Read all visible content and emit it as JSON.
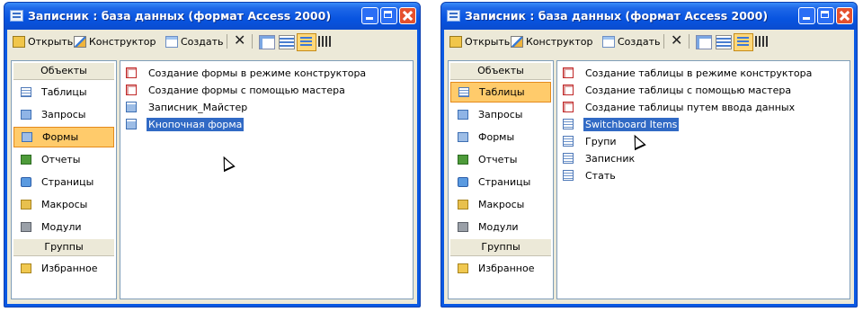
{
  "left": {
    "title": "Записник : база данных (формат Access 2000)",
    "toolbar": {
      "open": "Открыть",
      "design": "Конструктор",
      "create": "Создать",
      "delete": "✕"
    },
    "objects_header": "Объекты",
    "objects": [
      "Таблицы",
      "Запросы",
      "Формы",
      "Отчеты",
      "Страницы",
      "Макросы",
      "Модули"
    ],
    "selected_object": "Формы",
    "groups_header": "Группы",
    "groups": [
      "Избранное"
    ],
    "items": [
      {
        "label": "Создание формы в режиме конструктора",
        "icon": "wizard-icon"
      },
      {
        "label": "Создание формы с помощью мастера",
        "icon": "wizard-icon"
      },
      {
        "label": "Записник_Майстер",
        "icon": "form-icon"
      },
      {
        "label": "Кнопочная форма",
        "icon": "form-icon",
        "selected": true
      }
    ]
  },
  "right": {
    "title": "Записник : база данных (формат Access 2000)",
    "toolbar": {
      "open": "Открыть",
      "design": "Конструктор",
      "create": "Создать",
      "delete": "✕"
    },
    "objects_header": "Объекты",
    "objects": [
      "Таблицы",
      "Запросы",
      "Формы",
      "Отчеты",
      "Страницы",
      "Макросы",
      "Модули"
    ],
    "selected_object": "Таблицы",
    "groups_header": "Группы",
    "groups": [
      "Избранное"
    ],
    "items": [
      {
        "label": "Создание таблицы в режиме конструктора",
        "icon": "wizard-icon"
      },
      {
        "label": "Создание таблицы с помощью мастера",
        "icon": "wizard-icon"
      },
      {
        "label": "Создание таблицы путем ввода данных",
        "icon": "wizard-icon"
      },
      {
        "label": "Switchboard Items",
        "icon": "table-icon",
        "selected": true
      },
      {
        "label": "Групи",
        "icon": "table-icon"
      },
      {
        "label": "Записник",
        "icon": "table-icon"
      },
      {
        "label": "Стать",
        "icon": "table-icon"
      }
    ]
  },
  "colors": {
    "title_bar": "#0a54e0",
    "selection": "#316ac5",
    "selected_object": "#ffcb6b"
  }
}
